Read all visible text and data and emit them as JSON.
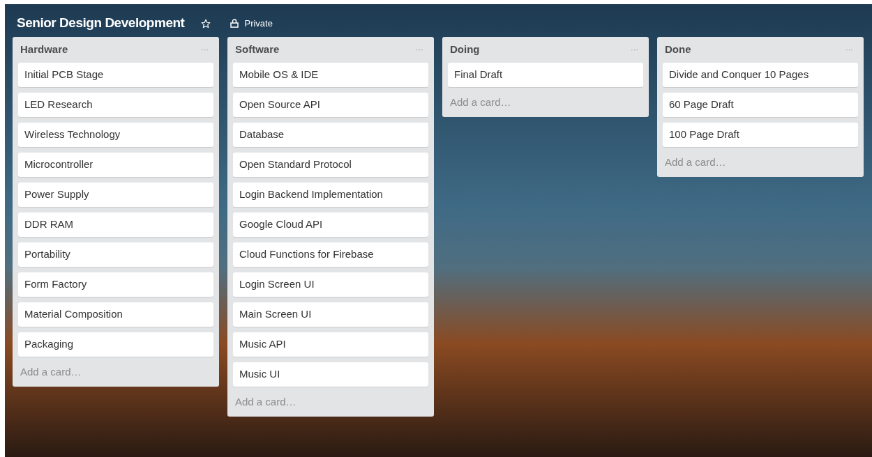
{
  "board": {
    "title": "Senior Design Development",
    "starred": false,
    "visibility": "Private"
  },
  "lists": [
    {
      "title": "Hardware",
      "menu": "···",
      "cards": [
        "Initial PCB Stage",
        "LED Research",
        "Wireless Technology",
        "Microcontroller",
        "Power Supply",
        "DDR RAM",
        "Portability",
        "Form Factory",
        "Material Composition",
        "Packaging"
      ],
      "add_card": "Add a card…"
    },
    {
      "title": "Software",
      "menu": "···",
      "cards": [
        "Mobile OS & IDE",
        "Open Source API",
        "Database",
        "Open Standard Protocol",
        "Login Backend Implementation",
        "Google Cloud API",
        "Cloud Functions for Firebase",
        "Login Screen UI",
        "Main Screen UI",
        "Music API",
        "Music UI"
      ],
      "add_card": "Add a card…"
    },
    {
      "title": "Doing",
      "menu": "···",
      "cards": [
        "Final Draft"
      ],
      "add_card": "Add a card…"
    },
    {
      "title": "Done",
      "menu": "···",
      "cards": [
        "Divide and Conquer 10 Pages",
        "60 Page Draft",
        "100 Page Draft"
      ],
      "add_card": "Add a card…"
    }
  ]
}
